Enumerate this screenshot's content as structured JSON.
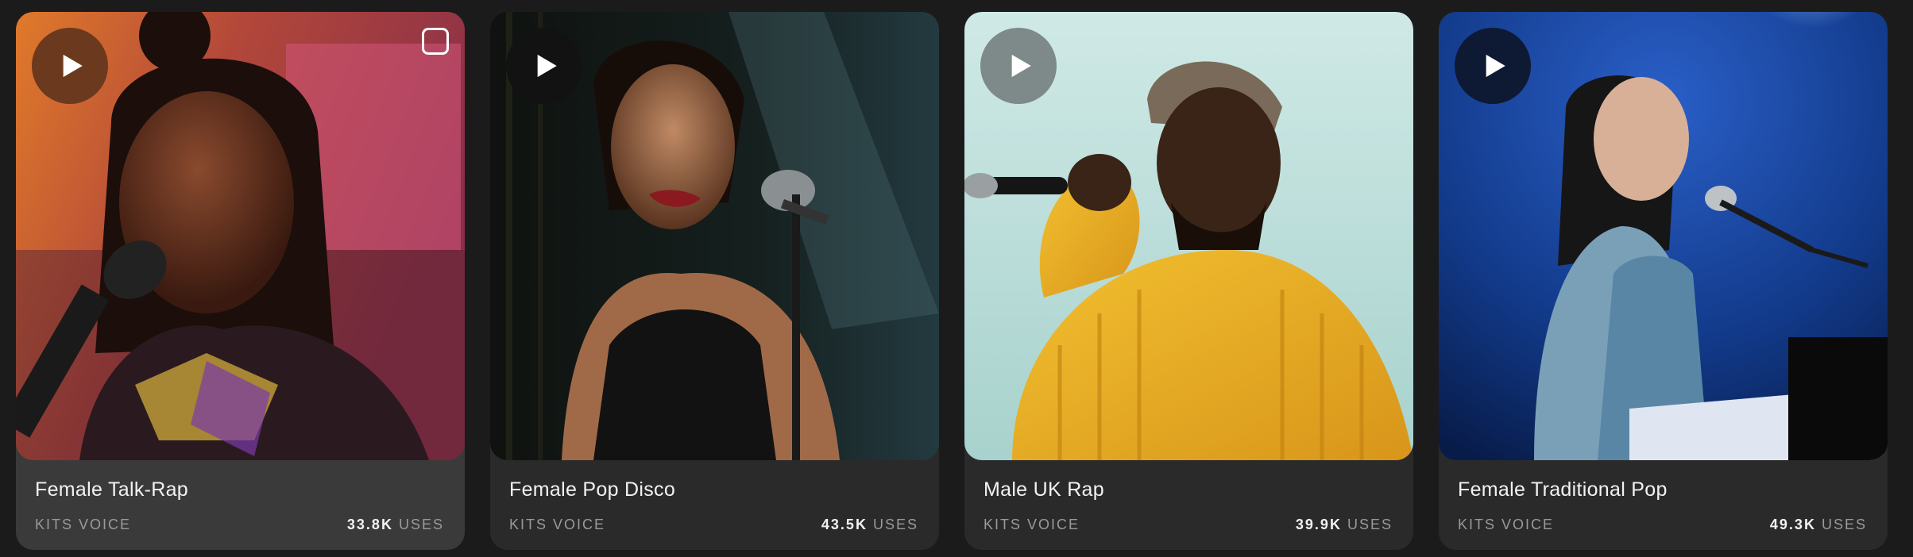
{
  "cards": [
    {
      "title": "Female Talk-Rap",
      "provider": "KITS VOICE",
      "uses_count": "33.8K",
      "uses_label": "USES",
      "play_icon": "play-icon",
      "play_bg": "#6b3a1e",
      "selected": true
    },
    {
      "title": "Female Pop Disco",
      "provider": "KITS VOICE",
      "uses_count": "43.5K",
      "uses_label": "USES",
      "play_icon": "play-icon",
      "play_bg": "#121212"
    },
    {
      "title": "Male UK Rap",
      "provider": "KITS VOICE",
      "uses_count": "39.9K",
      "uses_label": "USES",
      "play_icon": "play-icon",
      "play_bg": "#7d8a89"
    },
    {
      "title": "Female Traditional Pop",
      "provider": "KITS VOICE",
      "uses_count": "49.3K",
      "uses_label": "USES",
      "play_icon": "play-icon",
      "play_bg": "#0e1a33"
    }
  ]
}
